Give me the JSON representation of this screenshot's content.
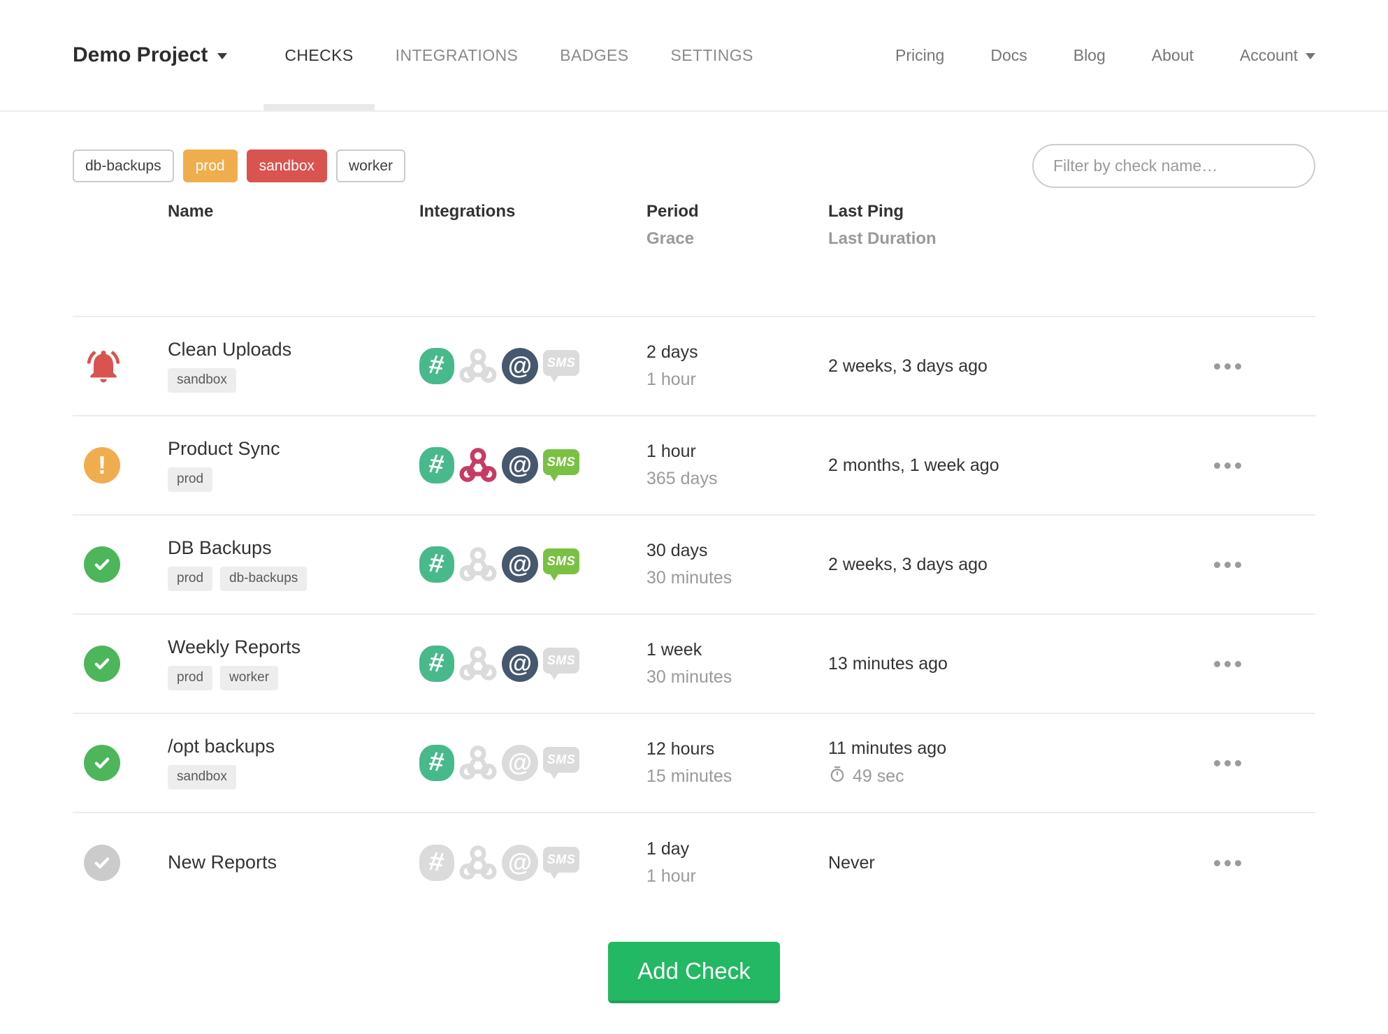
{
  "header": {
    "project": {
      "name": "Demo Project"
    },
    "tabs": [
      {
        "label": "CHECKS",
        "active": true
      },
      {
        "label": "INTEGRATIONS",
        "active": false
      },
      {
        "label": "BADGES",
        "active": false
      },
      {
        "label": "SETTINGS",
        "active": false
      }
    ],
    "links": [
      "Pricing",
      "Docs",
      "Blog",
      "About"
    ],
    "account_label": "Account"
  },
  "filters": {
    "tags": [
      {
        "label": "db-backups",
        "style": "default"
      },
      {
        "label": "prod",
        "style": "warning"
      },
      {
        "label": "sandbox",
        "style": "danger"
      },
      {
        "label": "worker",
        "style": "default"
      }
    ],
    "search_placeholder": "Filter by check name…"
  },
  "table": {
    "columns": {
      "name": "Name",
      "integrations": "Integrations",
      "period": "Period",
      "grace": "Grace",
      "last_ping": "Last Ping",
      "last_duration": "Last Duration"
    },
    "checks": [
      {
        "status": "late",
        "name": "Clean Uploads",
        "tags": [
          "sandbox"
        ],
        "integrations": {
          "slack": true,
          "webhook": false,
          "email": true,
          "sms": false
        },
        "period": "2 days",
        "grace": "1 hour",
        "last_ping": "2 weeks, 3 days ago",
        "last_duration": null
      },
      {
        "status": "grace",
        "name": "Product Sync",
        "tags": [
          "prod"
        ],
        "integrations": {
          "slack": true,
          "webhook": true,
          "email": true,
          "sms": true
        },
        "period": "1 hour",
        "grace": "365 days",
        "last_ping": "2 months, 1 week ago",
        "last_duration": null
      },
      {
        "status": "up",
        "name": "DB Backups",
        "tags": [
          "prod",
          "db-backups"
        ],
        "integrations": {
          "slack": true,
          "webhook": false,
          "email": true,
          "sms": true
        },
        "period": "30 days",
        "grace": "30 minutes",
        "last_ping": "2 weeks, 3 days ago",
        "last_duration": null
      },
      {
        "status": "up",
        "name": "Weekly Reports",
        "tags": [
          "prod",
          "worker"
        ],
        "integrations": {
          "slack": true,
          "webhook": false,
          "email": true,
          "sms": false
        },
        "period": "1 week",
        "grace": "30 minutes",
        "last_ping": "13 minutes ago",
        "last_duration": null
      },
      {
        "status": "up",
        "name": "/opt backups",
        "tags": [
          "sandbox"
        ],
        "integrations": {
          "slack": true,
          "webhook": false,
          "email": false,
          "sms": false
        },
        "period": "12 hours",
        "grace": "15 minutes",
        "last_ping": "11 minutes ago",
        "last_duration": "49 sec"
      },
      {
        "status": "new",
        "name": "New Reports",
        "tags": [],
        "integrations": {
          "slack": false,
          "webhook": false,
          "email": false,
          "sms": false
        },
        "period": "1 day",
        "grace": "1 hour",
        "last_ping": "Never",
        "last_duration": null
      }
    ]
  },
  "add_check_label": "Add Check",
  "icons": {
    "slack_glyph": "#",
    "email_glyph": "@",
    "sms_label": "SMS",
    "grace_glyph": "!"
  },
  "colors": {
    "c-late": "#d9534f",
    "c-grace": "#f0ad4e",
    "c-up": "#4db65a",
    "c-new": "#cbcbcb",
    "c-slack": "#48b98a",
    "c-webhook": "#c73a63",
    "c-email": "#46586e",
    "c-sms": "#7ac143",
    "c-inactive": "#dbdbdb",
    "c-accent": "#23b863"
  }
}
